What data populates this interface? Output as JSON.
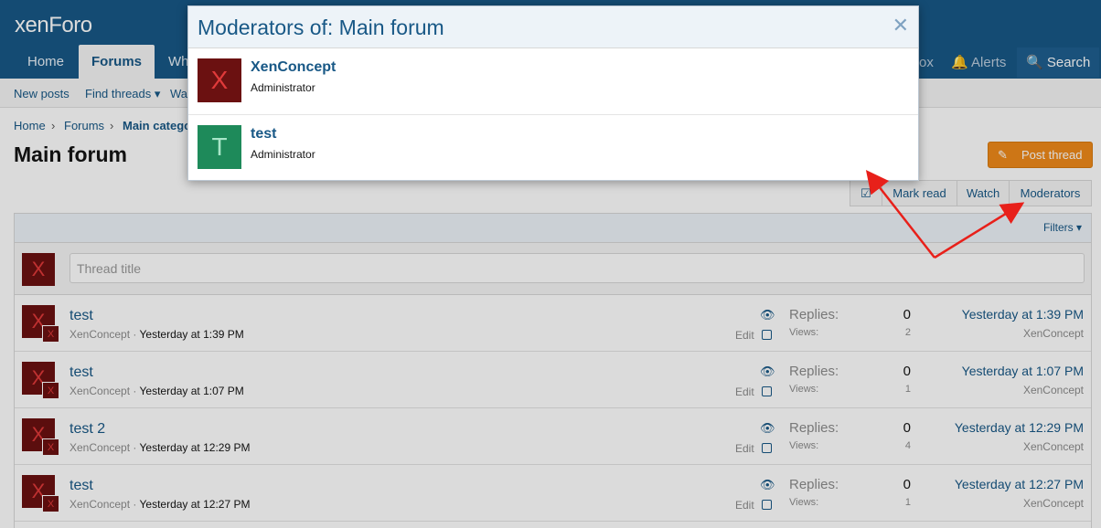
{
  "logo": "xenForo",
  "nav": {
    "tabs": [
      "Home",
      "Forums",
      "Wh"
    ],
    "right": [
      "ox",
      "Alerts",
      "Search"
    ]
  },
  "subnav": [
    "New posts",
    "Find threads ▾",
    "Wa"
  ],
  "breadcrumb": [
    "Home",
    "Forums",
    "Main catego"
  ],
  "page_title": "Main forum",
  "post_thread_label": "Post thread",
  "actions": {
    "mark_read": "Mark read",
    "watch": "Watch",
    "moderators": "Moderators"
  },
  "filters_label": "Filters ▾",
  "thread_title_placeholder": "Thread title",
  "labels": {
    "replies": "Replies:",
    "views": "Views:",
    "edit": "Edit"
  },
  "threads": [
    {
      "title": "test",
      "author": "XenConcept",
      "date": "Yesterday at 1:39 PM",
      "replies": "0",
      "views": "2",
      "last_date": "Yesterday at 1:39 PM",
      "last_user": "XenConcept"
    },
    {
      "title": "test",
      "author": "XenConcept",
      "date": "Yesterday at 1:07 PM",
      "replies": "0",
      "views": "1",
      "last_date": "Yesterday at 1:07 PM",
      "last_user": "XenConcept"
    },
    {
      "title": "test 2",
      "author": "XenConcept",
      "date": "Yesterday at 12:29 PM",
      "replies": "0",
      "views": "4",
      "last_date": "Yesterday at 12:29 PM",
      "last_user": "XenConcept"
    },
    {
      "title": "test",
      "author": "XenConcept",
      "date": "Yesterday at 12:27 PM",
      "replies": "0",
      "views": "1",
      "last_date": "Yesterday at 12:27 PM",
      "last_user": "XenConcept"
    }
  ],
  "modal": {
    "title": "Moderators of: Main forum",
    "moderators": [
      {
        "initial": "X",
        "name": "XenConcept",
        "role": "Administrator",
        "bg": "#6b1111",
        "fg": "#e03a3a"
      },
      {
        "initial": "T",
        "name": "test",
        "role": "Administrator",
        "bg": "#1e8a5a",
        "fg": "#a8e6c8"
      }
    ]
  },
  "avatar_initial": "X",
  "colors": {
    "header": "#185886",
    "accent_orange": "#ef8a1a",
    "annotation_arrow": "#e8201a"
  }
}
